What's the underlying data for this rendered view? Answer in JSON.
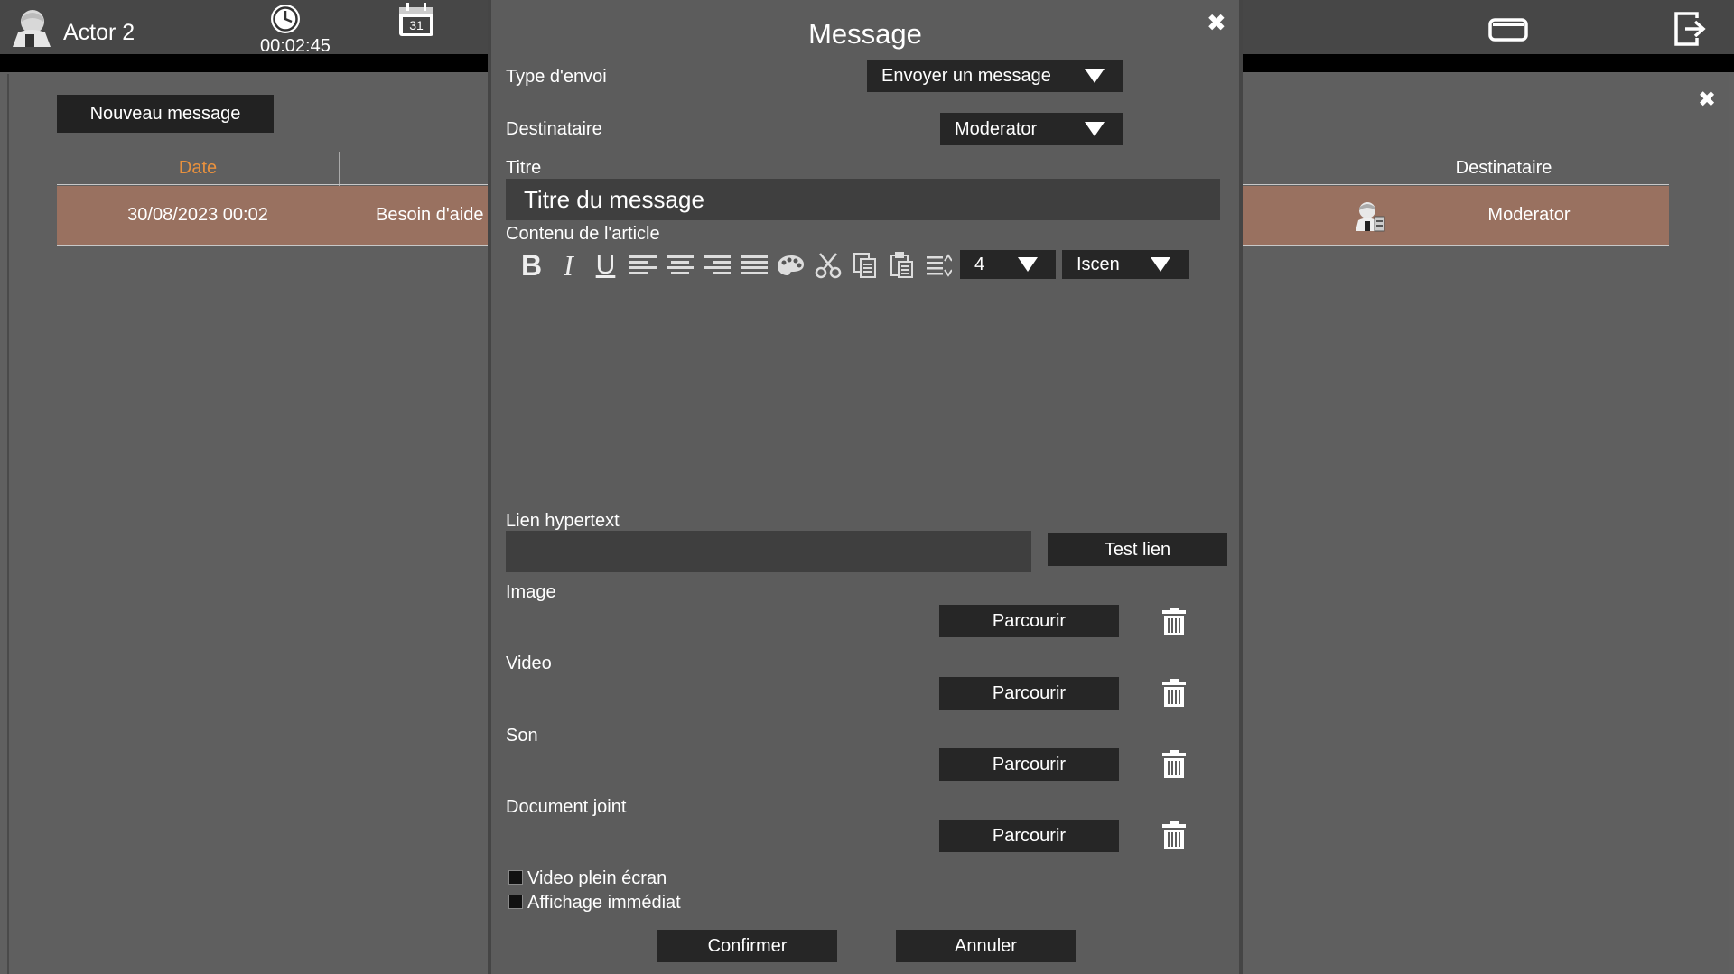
{
  "header": {
    "actor_name": "Actor 2",
    "timer": "00:02:45",
    "calendar_day": "31"
  },
  "background": {
    "new_message_label": "Nouveau message",
    "columns": {
      "date": "Date",
      "recipient": "Destinataire"
    },
    "row": {
      "date": "30/08/2023 00:02",
      "subject": "Besoin d'aide",
      "recipient": "Moderator"
    }
  },
  "dialog": {
    "title": "Message",
    "send_type_label": "Type d'envoi",
    "send_type_value": "Envoyer un message",
    "recipient_label": "Destinataire",
    "recipient_value": "Moderator",
    "title_label": "Titre",
    "title_value": "Titre du message",
    "content_label": "Contenu de l'article",
    "font_size_value": "4",
    "font_value": "Iscen",
    "link_label": "Lien hypertext",
    "link_value": "",
    "test_link_label": "Test lien",
    "image_label": "Image",
    "video_label": "Video",
    "sound_label": "Son",
    "attachment_label": "Document joint",
    "browse_label": "Parcourir",
    "fullscreen_video_label": "Video plein écran",
    "immediate_display_label": "Affichage immédiat",
    "confirm_label": "Confirmer",
    "cancel_label": "Annuler"
  },
  "colors": {
    "accent_header": "#e8913e",
    "row_highlight": "#997160",
    "button_dark": "#262626"
  }
}
